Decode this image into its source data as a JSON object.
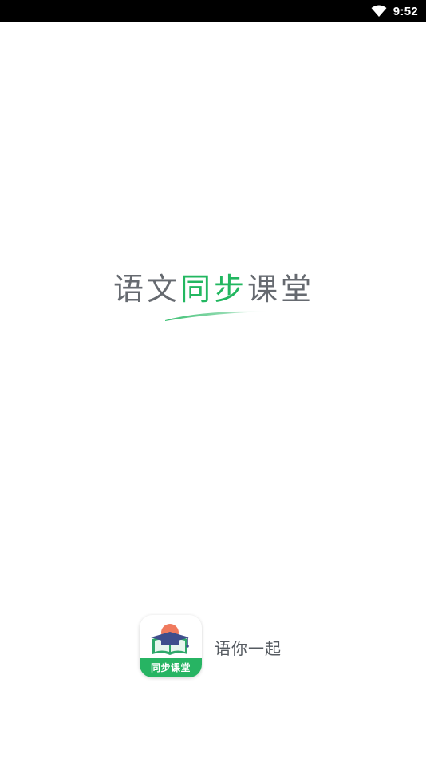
{
  "status_bar": {
    "time": "9:52",
    "wifi_icon": "wifi-icon"
  },
  "splash": {
    "title_part1": "语文",
    "title_part2": "同步",
    "title_part3": "课堂"
  },
  "brand": {
    "icon_label": "同步课堂",
    "slogan": "语你一起"
  },
  "colors": {
    "accent_green": "#22b760",
    "title_gray": "#666a70",
    "status_bar_bg": "#000000"
  }
}
